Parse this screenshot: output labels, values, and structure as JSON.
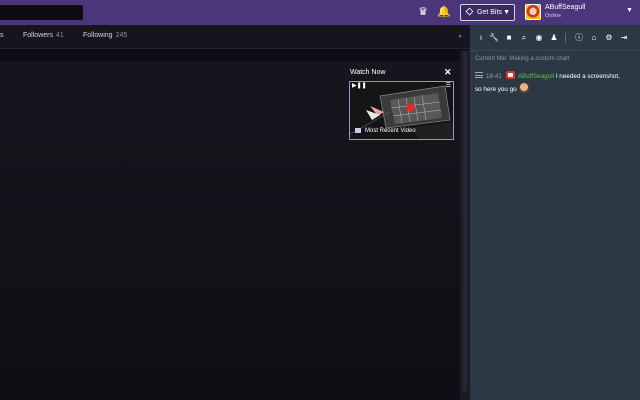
{
  "header": {
    "get_bits_label": "Get Bits",
    "user": {
      "name": "ABuffSeagull",
      "status": "Online"
    }
  },
  "channel_nav": {
    "tabs": [
      {
        "label": "s",
        "count": ""
      },
      {
        "label": "Followers",
        "count": "41"
      },
      {
        "label": "Following",
        "count": "245"
      }
    ]
  },
  "watch_now": {
    "title": "Watch Now",
    "close": "✕",
    "video_label": "Most Recent Video"
  },
  "chat": {
    "current_title": "Current title: Making a custom chart",
    "message": {
      "time": "18:41",
      "user": "ABuffSeagull",
      "text_line1": "I needed a screenshot,",
      "text_line2": "so here you go"
    }
  },
  "colors": {
    "topbar": "#4b367c",
    "chat_bg": "#2c3945",
    "username": "#61c04d",
    "accent_border": "#a58dd7"
  }
}
